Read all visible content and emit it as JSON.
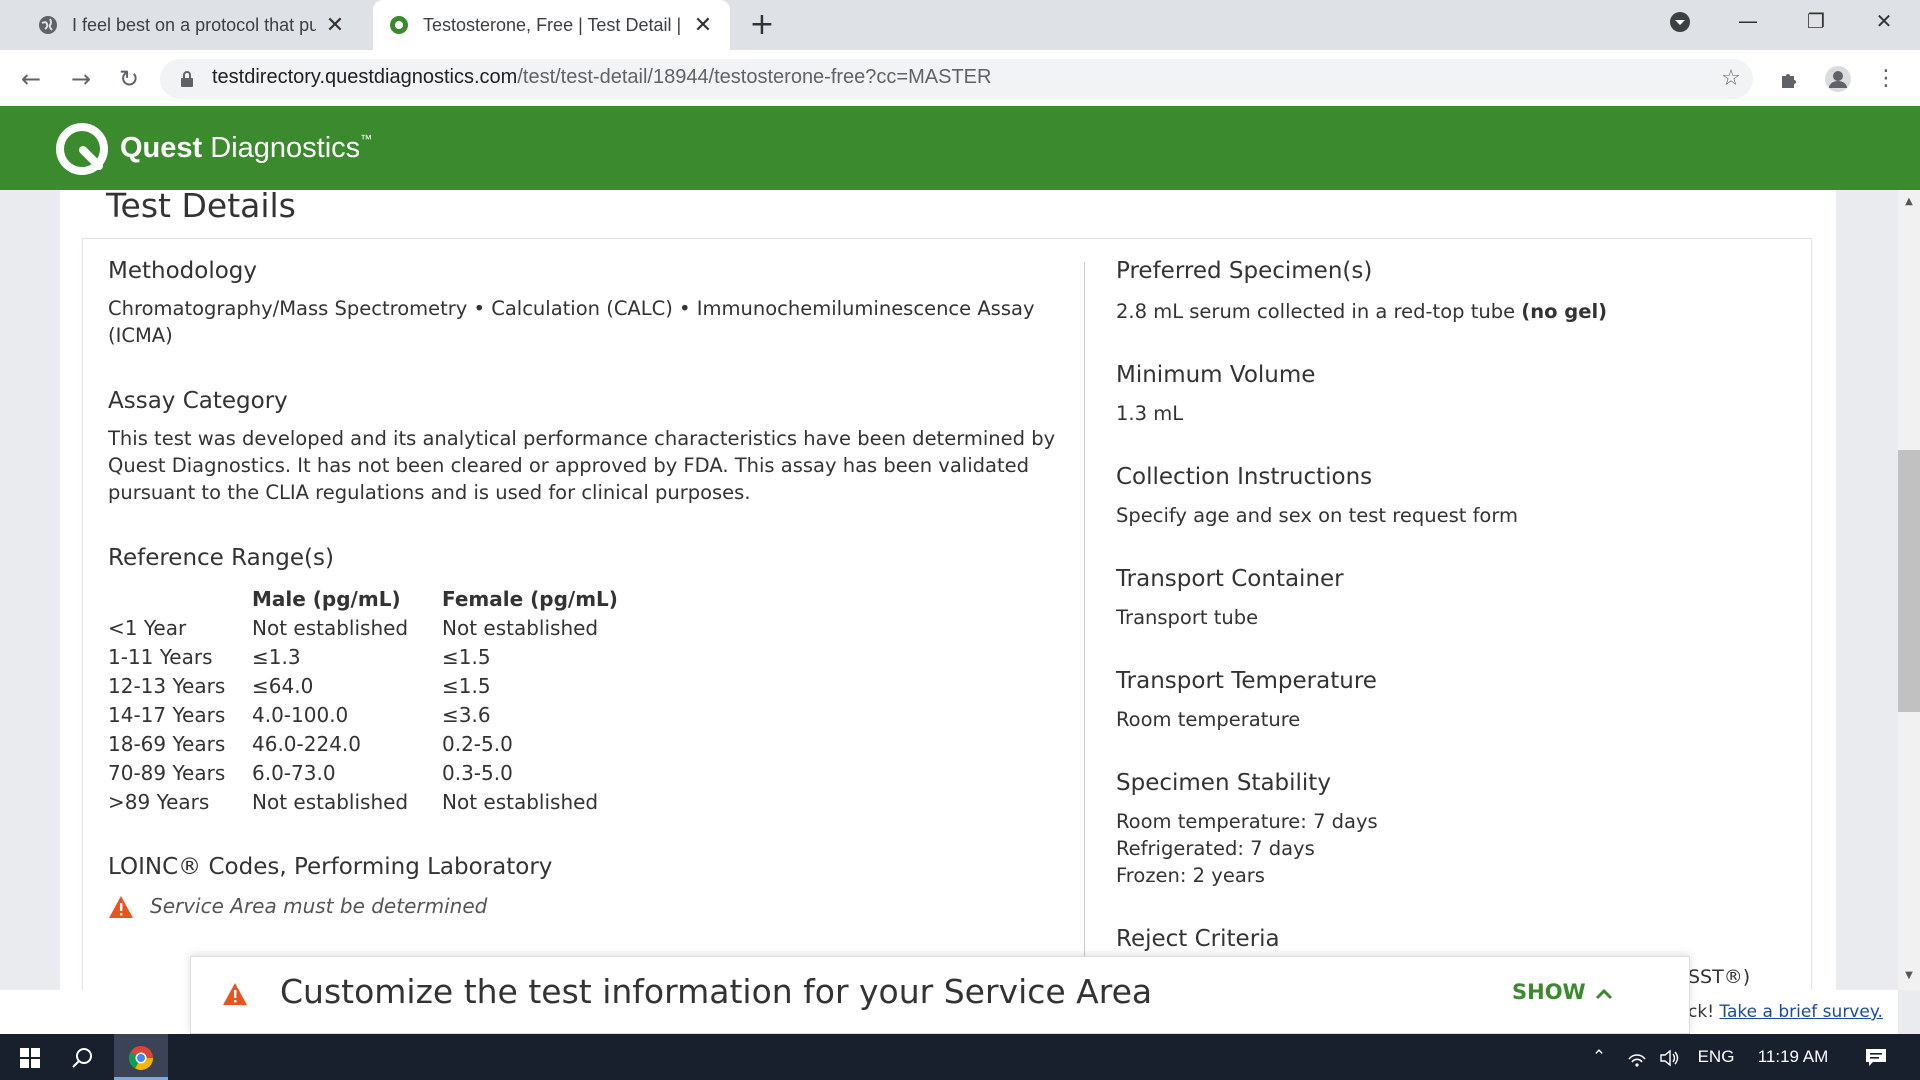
{
  "browser": {
    "tabs": [
      {
        "title": "I feel best on a protocol that puts",
        "active": false
      },
      {
        "title": "Testosterone, Free | Test Detail | Q",
        "active": true
      }
    ],
    "new_tab_label": "+",
    "url_host": "testdirectory.questdiagnostics.com",
    "url_path": "/test/test-detail/18944/testosterone-free?cc=MASTER"
  },
  "site": {
    "brand_bold": "Quest",
    "brand_light": " Diagnostics",
    "brand_tm": "™",
    "brand_color": "#3b8a2e"
  },
  "page": {
    "title": "Test Details",
    "left": {
      "methodology_heading": "Methodology",
      "methodology_text": "Chromatography/Mass Spectrometry • Calculation (CALC) • Immunochemiluminescence Assay (ICMA)",
      "assay_heading": "Assay Category",
      "assay_text": "This test was developed and its analytical performance characteristics have been determined by Quest Diagnostics. It has not been cleared or approved by FDA. This assay has been validated pursuant to the CLIA regulations and is used for clinical purposes.",
      "reference_heading": "Reference Range(s)",
      "reference_table": {
        "headers": [
          "",
          "Male (pg/mL)",
          "Female (pg/mL)"
        ],
        "rows": [
          [
            "<1 Year",
            "Not established",
            "Not established"
          ],
          [
            "1-11 Years",
            "≤1.3",
            "≤1.5"
          ],
          [
            "12-13 Years",
            "≤64.0",
            "≤1.5"
          ],
          [
            "14-17 Years",
            "4.0-100.0",
            "≤3.6"
          ],
          [
            "18-69 Years",
            "46.0-224.0",
            "0.2-5.0"
          ],
          [
            "70-89 Years",
            "6.0-73.0",
            "0.3-5.0"
          ],
          [
            ">89 Years",
            "Not established",
            "Not established"
          ]
        ]
      },
      "loinc_heading": "LOINC® Codes, Performing Laboratory",
      "service_note": "Service Area must be determined"
    },
    "right": {
      "preferred_heading": "Preferred Specimen(s)",
      "preferred_text": "2.8 mL serum collected in a red-top tube ",
      "preferred_bold": "(no gel)",
      "min_volume_heading": "Minimum Volume",
      "min_volume_text": "1.3 mL",
      "collection_heading": "Collection Instructions",
      "collection_text": "Specify age and sex on test request form",
      "transport_container_heading": "Transport Container",
      "transport_container_text": "Transport tube",
      "transport_temp_heading": "Transport Temperature",
      "transport_temp_text": "Room temperature",
      "stability_heading": "Specimen Stability",
      "stability_lines": [
        "Room temperature: 7 days",
        "Refrigerated: 7 days",
        "Frozen: 2 years"
      ],
      "reject_heading": "Reject Criteria"
    }
  },
  "banner": {
    "text": "Customize the test information for your Service Area",
    "show_label": "SHOW",
    "peek_line1": "SST®)",
    "peek_line2_prefix": "ck! ",
    "peek_line2_link": "Take a brief survey."
  },
  "taskbar": {
    "language": "ENG",
    "time": "11:19 AM"
  }
}
